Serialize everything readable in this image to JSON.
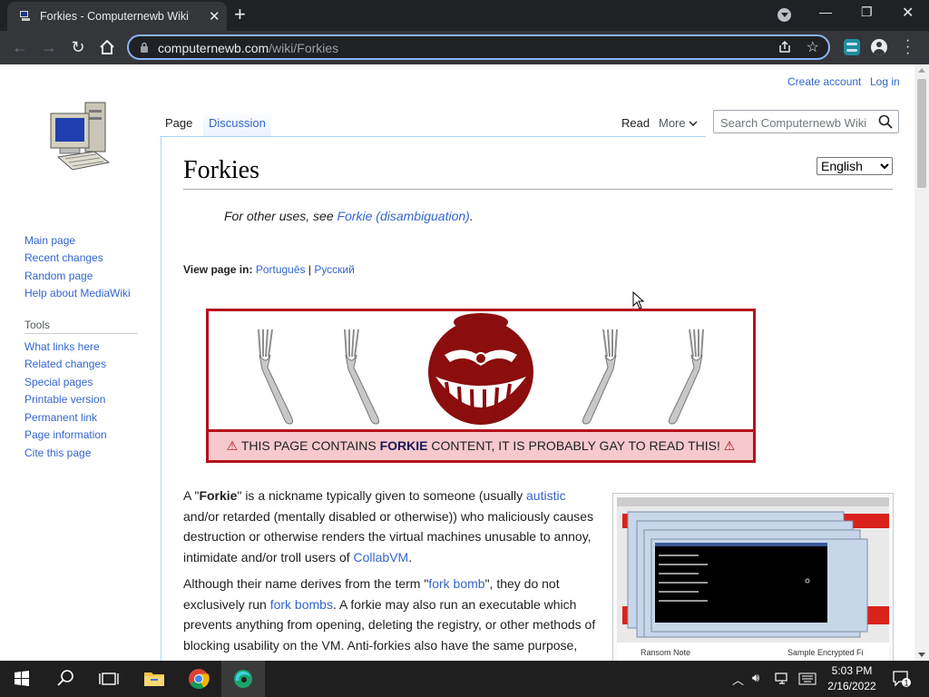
{
  "browser": {
    "tab_title": "Forkies - Computernewb Wiki",
    "url_host": "computernewb.com",
    "url_path": "/wiki/Forkies"
  },
  "personal": {
    "create_account": "Create account",
    "log_in": "Log in"
  },
  "sidebar": {
    "nav": [
      "Main page",
      "Recent changes",
      "Random page",
      "Help about MediaWiki"
    ],
    "tools_heading": "Tools",
    "tools": [
      "What links here",
      "Related changes",
      "Special pages",
      "Printable version",
      "Permanent link",
      "Page information",
      "Cite this page"
    ]
  },
  "page_tabs": {
    "page": "Page",
    "discussion": "Discussion",
    "read": "Read",
    "more": "More"
  },
  "search": {
    "placeholder": "Search Computernewb Wiki"
  },
  "article": {
    "title": "Forkies",
    "language_selected": "English",
    "hatnote_prefix": "For other uses, see ",
    "hatnote_link": "Forkie (disambiguation)",
    "hatnote_suffix": ".",
    "view_in_label": "View page in:",
    "view_in_langs": [
      "Português",
      "Русский"
    ],
    "banner": {
      "before": "THIS PAGE CONTAINS ",
      "bold": "FORKIE",
      "after": " CONTENT, IT IS PROBABLY GAY TO READ THIS!"
    },
    "p1": {
      "t1": "A \"",
      "b1": "Forkie",
      "t2": "\" is a nickname typically given to someone (usually ",
      "l1": "autistic",
      "t3": " and/or retarded (mentally disabled or otherwise)) who maliciously causes destruction or otherwise renders the virtual machines unusable to annoy, intimidate and/or troll users of ",
      "l2": "CollabVM",
      "t4": "."
    },
    "p2": {
      "t1": "Although their name derives from the term \"",
      "l1": "fork bomb",
      "t2": "\", they do not exclusively run ",
      "l2": "fork bombs",
      "t3": ". A forkie may also run an executable which prevents anything from opening, deleting the registry, or other methods of blocking usability on the VM. Anti-forkies also have the same purpose,"
    },
    "thumb_labels": {
      "left": "Ransom Note",
      "right": "Sample Encrypted Fi"
    }
  },
  "taskbar": {
    "time": "5:03 PM",
    "date": "2/16/2022",
    "notifications": "1"
  },
  "colors": {
    "link": "#3366cc",
    "banner_border": "#b40f1c",
    "banner_bar": "#f6c9cc",
    "chrome_dark": "#202124"
  }
}
